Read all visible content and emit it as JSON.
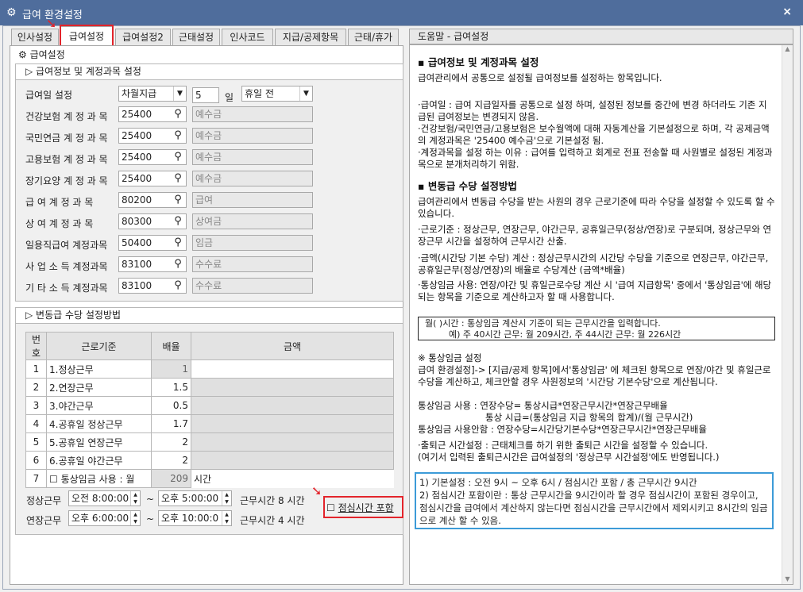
{
  "window": {
    "title": "급여 환경설정",
    "close": "×"
  },
  "tabs": [
    {
      "label": "인사설정",
      "active": false
    },
    {
      "label": "급여설정",
      "active": true
    },
    {
      "label": "급여설정2",
      "active": false
    },
    {
      "label": "근태설정",
      "active": false
    },
    {
      "label": "인사코드",
      "active": false
    },
    {
      "label": "지급/공제항목",
      "active": false
    },
    {
      "label": "근태/휴가",
      "active": false
    }
  ],
  "panel": {
    "title": "급여설정",
    "icon": "gear-icon"
  },
  "group1": {
    "title": "급여정보 및 계정과목 설정",
    "payday_label": "급여일 설정",
    "payday_type": "차월지급",
    "payday_day": "5",
    "payday_unit": "일",
    "payday_holiday": "휴일 전",
    "accounts": [
      {
        "label": "건강보험 계 정 과 목",
        "code": "25400",
        "name": "예수금"
      },
      {
        "label": "국민연금 계 정 과 목",
        "code": "25400",
        "name": "예수금"
      },
      {
        "label": "고용보험 계 정 과 목",
        "code": "25400",
        "name": "예수금"
      },
      {
        "label": "장기요양 계 정 과 목",
        "code": "25400",
        "name": "예수금"
      },
      {
        "label": "급 여 계 정 과 목",
        "code": "80200",
        "name": "급여"
      },
      {
        "label": "상 여 계 정 과 목",
        "code": "80300",
        "name": "상여금"
      },
      {
        "label": "일용직급여 계정과목",
        "code": "50400",
        "name": "임금"
      },
      {
        "label": "사 업 소 득 계정과목",
        "code": "83100",
        "name": "수수료"
      },
      {
        "label": "기 타 소 득 계정과목",
        "code": "83100",
        "name": "수수료"
      }
    ]
  },
  "group2": {
    "title": "변동급 수당 설정방법",
    "headers": [
      "번호",
      "근로기준",
      "배율",
      "금액"
    ],
    "rows": [
      {
        "no": "1",
        "name": "1.정상근무",
        "rate": "1"
      },
      {
        "no": "2",
        "name": "2.연장근무",
        "rate": "1.5"
      },
      {
        "no": "3",
        "name": "3.야간근무",
        "rate": "0.5"
      },
      {
        "no": "4",
        "name": "4.공휴일 정상근무",
        "rate": "1.7"
      },
      {
        "no": "5",
        "name": "5.공휴일 연장근무",
        "rate": "2"
      },
      {
        "no": "6",
        "name": "6.공휴일 야간근무",
        "rate": "2"
      }
    ],
    "row7": {
      "no": "7",
      "label": "통상임금 사용 : 월",
      "value": "209",
      "unit": "시간"
    },
    "normal_label": "정상근무",
    "normal_start": "오전 8:00:00",
    "normal_end": "오후 5:00:00",
    "tilde": "~",
    "normal_hours": "근무시간  8 시간",
    "overtime_label": "연장근무",
    "overtime_start": "오후 6:00:00",
    "overtime_end": "오후 10:00:0",
    "overtime_hours": "근무시간  4 시간",
    "lunch_label": "점심시간 포함"
  },
  "help": {
    "title": "도움말 - 급여설정",
    "s1_title": "급여정보 및 계정과목 설정",
    "s1_intro": "급여관리에서 공통으로 설정될 급여정보를 설정하는 항목입니다.",
    "s1_b1": "·급여일 : 급여 지급일자를 공통으로 설정 하며, 설정된 정보를 중간에 변경 하더라도 기존 지급된 급여정보는 변경되지 않음.",
    "s1_b2": "·건강보험/국민연금/고용보험은 보수월액에 대해 자동계산을 기본설정으로 하며, 각 공제금액의 계정과목은 '25400 예수금'으로 기본설정 됨.",
    "s1_b3": "·계정과목을 설정 하는 이유 : 급여를 입력하고 회계로 전표 전송할 때 사원별로 설정된 계정과목으로 분개처리하기 위함.",
    "s2_title": "변동급 수당 설정방법",
    "s2_intro": "급여관리에서 변동급 수당을 받는 사원의 경우 근로기준에 따라 수당을 설정할 수 있도록 할 수 있습니다.",
    "s2_b1": "·근로기준 : 정상근무, 연장근무, 야간근무, 공휴일근무(정상/연장)로 구분되며, 정상근무와 연장근무 시간을 설정하여 근무시간 산출.",
    "s2_b2": "·금액(시간당 기본 수당) 계산 : 정상근무시간의 시간당 수당을 기준으로 연장근무, 야간근무, 공휴일근무(정상/연장)의 배율로 수당계산 (금액*배율)",
    "s2_b3": "·통상임금 사용: 연장/야간 및 휴일근로수당 계산 시 '급여 지급항목' 중에서 '통상임금'에 해당되는 항목을 기준으로 계산하고자 할 때 사용합니다.",
    "box1_l1": "월( )시간 : 통상임금 계산시 기준이 되는 근무시간을 입력합니다.",
    "box1_l2": "예) 주 40시간 근무: 월 209시간, 주 44시간 근무: 월 226시간",
    "s3_title": "※ 통상임금 설정",
    "s3_t1": "급여 환경설정]-> [지급/공제 항목]에서'통상임금' 에 체크된 항목으로 연장/야간 및 휴일근로수당을 계산하고, 체크안할 경우 사원정보의 '시간당 기본수당'으로 계산됩니다.",
    "s3_t2": "통상임금 사용 : 연장수당= 통상시급*연장근무시간*연장근무배율",
    "s3_t3": "통상 시급=(통상임금 지급 항목의 합계)/(월 근무시간)",
    "s3_t4": "통상임금 사용안함 : 연장수당=시간당기본수당*연장근무시간*연장근무배율",
    "s4_t1": "·출퇴근 시간설정 : 근태체크를 하기 위한 출퇴근 시간을 설정할 수 있습니다.",
    "s4_t2": "(여기서 입력된 출퇴근시간은 급여설정의 '정상근무 시간설정'에도 반영됩니다.)",
    "box2_l1": "1) 기본설정 : 오전 9시 ~ 오후 6시 / 점심시간 포함 / 총 근무시간 9시간",
    "box2_l2": "2) 점심시간 포함이란 : 통상 근무시간을 9시간이라 할 경우 점심시간이 포함된 경우이고, 점심시간을 급여에서 계산하지 않는다면 점심시간을 근무시간에서 제외시키고 8시간의 임금으로 계산 할 수 있음."
  },
  "colors": {
    "titlebar": "#4f6d9c",
    "highlight": "#e3242b",
    "info_border": "#3c9bd8"
  }
}
